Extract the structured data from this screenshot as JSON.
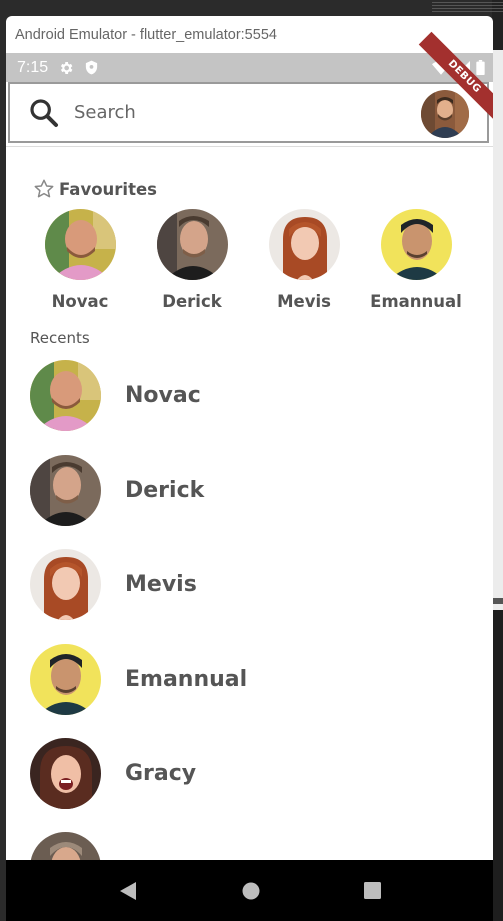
{
  "window": {
    "title": "Android Emulator - flutter_emulator:5554"
  },
  "status_bar": {
    "time": "7:15",
    "settings_icon": "gear-icon",
    "shield_icon": "shield-icon",
    "wifi_icon": "wifi-icon",
    "signal_icon": "signal-icon",
    "battery_icon": "battery-icon"
  },
  "debug_banner": "DEBUG",
  "search": {
    "placeholder": "Search",
    "icon": "search-icon"
  },
  "favourites": {
    "title": "Favourites",
    "icon": "star-outline-icon",
    "items": [
      {
        "name": "Novac"
      },
      {
        "name": "Derick"
      },
      {
        "name": "Mevis"
      },
      {
        "name": "Emannual"
      }
    ]
  },
  "recents": {
    "title": "Recents",
    "items": [
      {
        "name": "Novac"
      },
      {
        "name": "Derick"
      },
      {
        "name": "Mevis"
      },
      {
        "name": "Emannual"
      },
      {
        "name": "Gracy"
      },
      {
        "name": ""
      }
    ]
  },
  "nav": {
    "back_icon": "back-triangle-icon",
    "home_icon": "home-circle-icon",
    "recents_icon": "recents-square-icon"
  },
  "colors": {
    "debug_banner": "#a3302e",
    "status_bar": "#c4c4c4",
    "text": "#555555"
  }
}
